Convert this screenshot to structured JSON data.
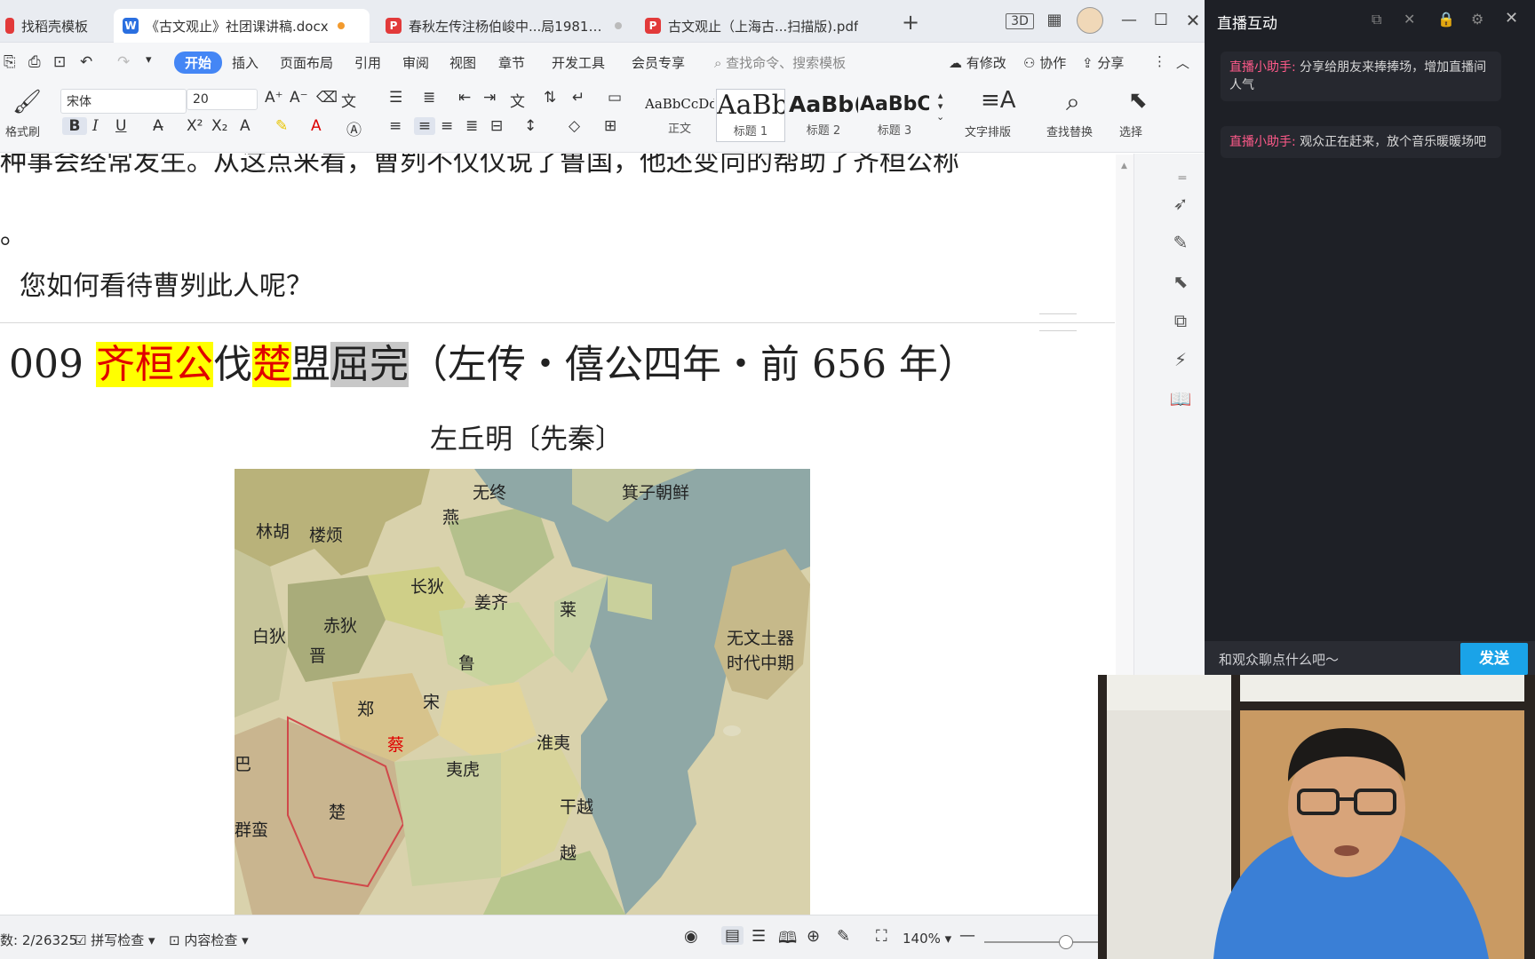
{
  "tabs": [
    {
      "label": "找稻壳模板"
    },
    {
      "label": "《古文观止》社团课讲稿.docx"
    },
    {
      "label": "春秋左传注杨伯峻中...局1981.pdf"
    },
    {
      "label": "古文观止（上海古...扫描版).pdf"
    }
  ],
  "ribbon": {
    "menus": [
      "开始",
      "插入",
      "页面布局",
      "引用",
      "审阅",
      "视图",
      "章节",
      "开发工具",
      "会员专享"
    ],
    "search_placeholder": "查找命令、搜索模板",
    "right": [
      "有修改",
      "协作",
      "分享"
    ],
    "format_painter": "格式刷",
    "font_name": "宋体",
    "font_size": "20",
    "styles": [
      {
        "preview": "AaBbCcDd",
        "label": "正文"
      },
      {
        "preview": "AaBb",
        "label": "标题 1"
      },
      {
        "preview": "AaBb(",
        "label": "标题 2"
      },
      {
        "preview": "AaBbC",
        "label": "标题 3"
      }
    ],
    "big_buttons": [
      "文字排版",
      "查找替换",
      "选择"
    ]
  },
  "doc": {
    "cutoff_line": "种事会经常发生。从这点来看，曹刿不仅仅说了鲁国，他还变向的帮助了齐桓公称",
    "period": "。",
    "question": "您如何看待曹刿此人呢？",
    "heading": {
      "number": "009 ",
      "part1": "齐桓公",
      "part2": "伐",
      "part3": "楚",
      "part4": "盟",
      "part5": "屈完",
      "part6": "（左传・僖公四年・前 656 年）"
    },
    "author": "左丘明〔先秦〕",
    "map_labels": [
      "无终",
      "箕子朝鲜",
      "林胡",
      "楼烦",
      "燕",
      "长狄",
      "姜齐",
      "莱",
      "白狄",
      "赤狄",
      "晋",
      "鲁",
      "无文土器",
      "时代中期",
      "郑",
      "宋",
      "淮夷",
      "蔡",
      "夷虎",
      "巴",
      "楚",
      "群蛮",
      "干越",
      "越"
    ]
  },
  "status": {
    "word_count": "数: 2/26325",
    "spell_check": "拼写检查",
    "content_check": "内容检查",
    "zoom": "140%"
  },
  "live": {
    "title": "直播互动",
    "messages": [
      {
        "sender": "直播小助手: ",
        "text": "分享给朋友来捧捧场，增加直播间人气"
      },
      {
        "sender": "直播小助手: ",
        "text": "观众正在赶来，放个音乐暖暖场吧"
      }
    ],
    "input_placeholder": "和观众聊点什么吧～",
    "send_label": "发送"
  }
}
